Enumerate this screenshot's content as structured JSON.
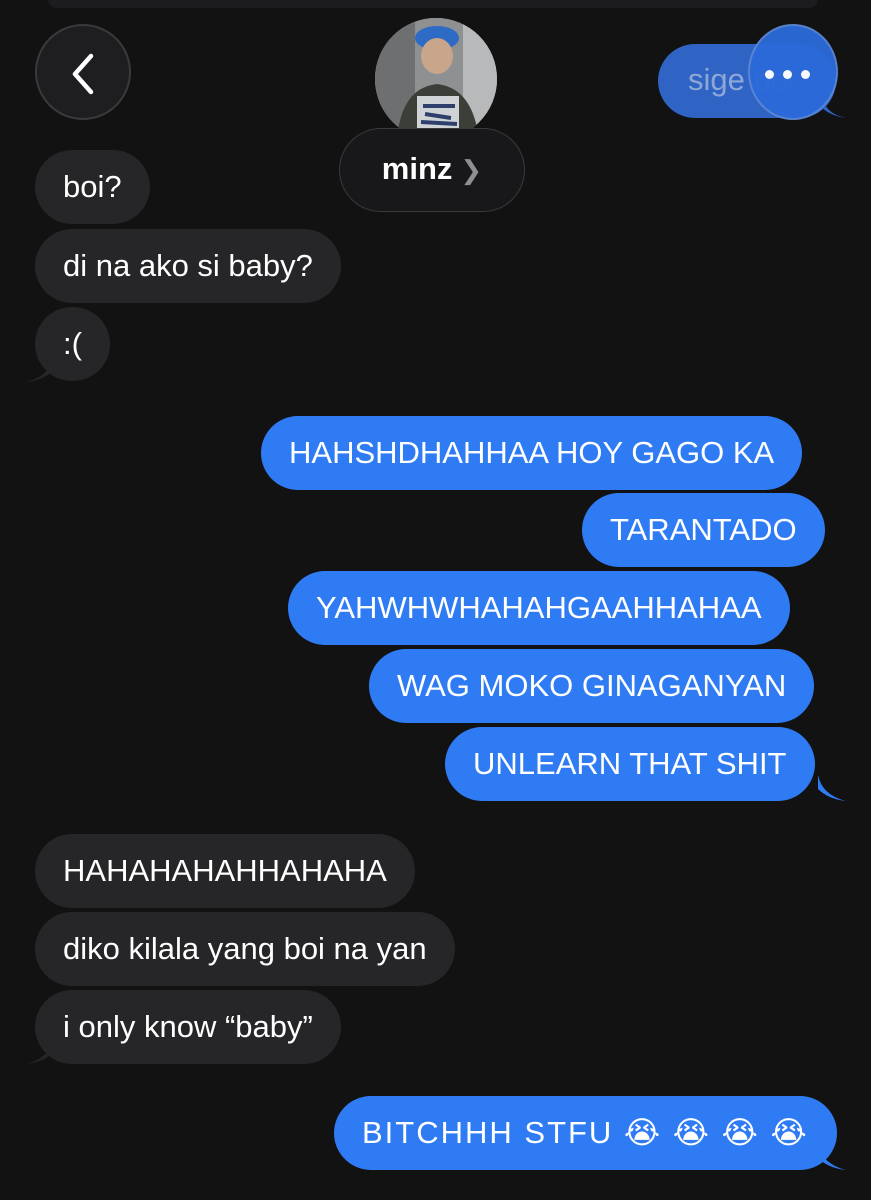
{
  "header": {
    "contact_name": "minz",
    "contact_chevron": "❯",
    "peek_text": "sige boi"
  },
  "messages": {
    "m1": "boi?",
    "m2": "di na ako si baby?",
    "m3": ":(",
    "m4": "HAHSHDHAHHAA HOY GAGO KA",
    "m5": "TARANTADO",
    "m6": "YAHWHWHAHAHGAAHHAHAA",
    "m7": "WAG MOKO GINAGANYAN",
    "m8": "UNLEARN THAT SHIT",
    "m9": "HAHAHAHAHHAHAHA",
    "m10": "diko kilala yang boi na yan",
    "m11": "i only know “baby”",
    "m12": "BITCHHH STFU 😭 😭 😭 😭"
  },
  "colors": {
    "background": "#121212",
    "incoming_bubble": "#262628",
    "outgoing_bubble": "#2f7bf4"
  },
  "icons": {
    "back": "chevron-left-icon",
    "more": "ellipsis-icon",
    "name_chevron": "chevron-right-icon"
  }
}
